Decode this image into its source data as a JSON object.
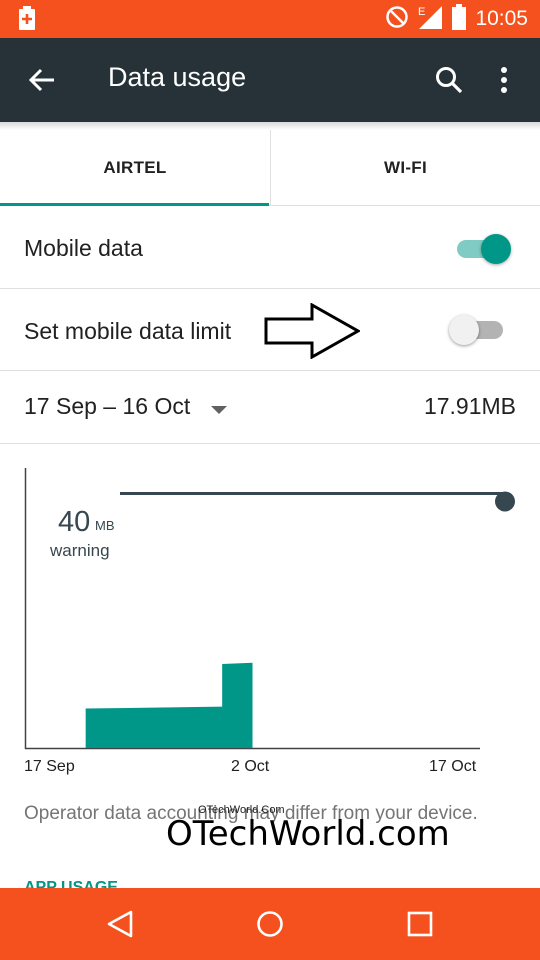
{
  "status_bar": {
    "time": "10:05",
    "network_badge": "E",
    "icons": [
      "notification-icon",
      "no-disturb-icon",
      "signal-icon",
      "battery-icon"
    ]
  },
  "toolbar": {
    "title": "Data usage"
  },
  "tabs": [
    {
      "label": "AIRTEL",
      "selected": true
    },
    {
      "label": "WI-FI",
      "selected": false
    }
  ],
  "settings": {
    "mobile_data": {
      "label": "Mobile data",
      "enabled": true
    },
    "data_limit": {
      "label": "Set mobile data limit",
      "enabled": false
    },
    "cycle": {
      "label": "17 Sep – 16 Oct",
      "usage": "17.91MB"
    }
  },
  "chart_data": {
    "type": "area",
    "warning": {
      "value": "40",
      "unit": "MB",
      "label": "warning"
    },
    "x_tick_labels": [
      "17 Sep",
      "2 Oct",
      "17 Oct"
    ],
    "x": [
      "17 Sep",
      "2 Oct",
      "17 Oct"
    ],
    "series": [
      {
        "values": [
          {
            "day": 4,
            "mb": 6.2
          },
          {
            "day": 13,
            "mb": 6.5
          },
          {
            "day": 13,
            "mb": 13.2
          },
          {
            "day": 15,
            "mb": 13.4
          }
        ]
      }
    ],
    "ylim": [
      0,
      44
    ],
    "color": "#009688"
  },
  "footnote": "Operator data accounting may differ from your device.",
  "watermark": {
    "large": "OTechWorld.com",
    "small": "OTechWorld.Com"
  },
  "apps_peek": "APP USAGE",
  "colors": {
    "accent": "#009688",
    "status_bar": "#f4511e",
    "toolbar": "#263238"
  }
}
